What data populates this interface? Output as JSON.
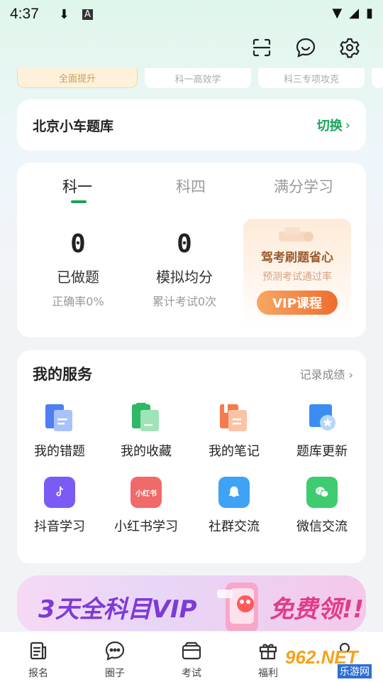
{
  "status_bar": {
    "time": "4:37"
  },
  "top_chips": [
    "全面提升",
    "科一高效学",
    "科三专项攻克"
  ],
  "bank": {
    "title": "北京小车题库",
    "switch_label": "切换"
  },
  "study": {
    "tabs": [
      "科一",
      "科四",
      "满分学习"
    ],
    "done": {
      "value": "0",
      "label": "已做题",
      "sub": "正确率0%"
    },
    "avg": {
      "value": "0",
      "label": "模拟均分",
      "sub": "累计考试0次"
    },
    "vip": {
      "title": "驾考刷题省心",
      "sub": "预测考试通过率",
      "button": "VIP课程"
    }
  },
  "services": {
    "title": "我的服务",
    "more": "记录成绩",
    "items": [
      {
        "label": "我的错题",
        "icon": "wrong-questions-icon",
        "color": "#5b8df0"
      },
      {
        "label": "我的收藏",
        "icon": "favorites-icon",
        "color": "#3dc271"
      },
      {
        "label": "我的笔记",
        "icon": "notes-icon",
        "color": "#f47b4a"
      },
      {
        "label": "题库更新",
        "icon": "bank-update-icon",
        "color": "#3b8df2"
      },
      {
        "label": "抖音学习",
        "icon": "douyin-icon",
        "color": "#7a5cf5"
      },
      {
        "label": "小红书学习",
        "icon": "xiaohongshu-icon",
        "color": "#f06a6a",
        "badge": "小红书"
      },
      {
        "label": "社群交流",
        "icon": "community-icon",
        "color": "#3ea3f5"
      },
      {
        "label": "微信交流",
        "icon": "wechat-icon",
        "color": "#3fcb6f"
      }
    ]
  },
  "banner": {
    "left": "3天全科目VIP",
    "right": "免费领!!"
  },
  "tabbar": [
    "报名",
    "圈子",
    "考试",
    "福利"
  ],
  "watermark": {
    "brand": "962.NET",
    "site": "乐游网"
  }
}
